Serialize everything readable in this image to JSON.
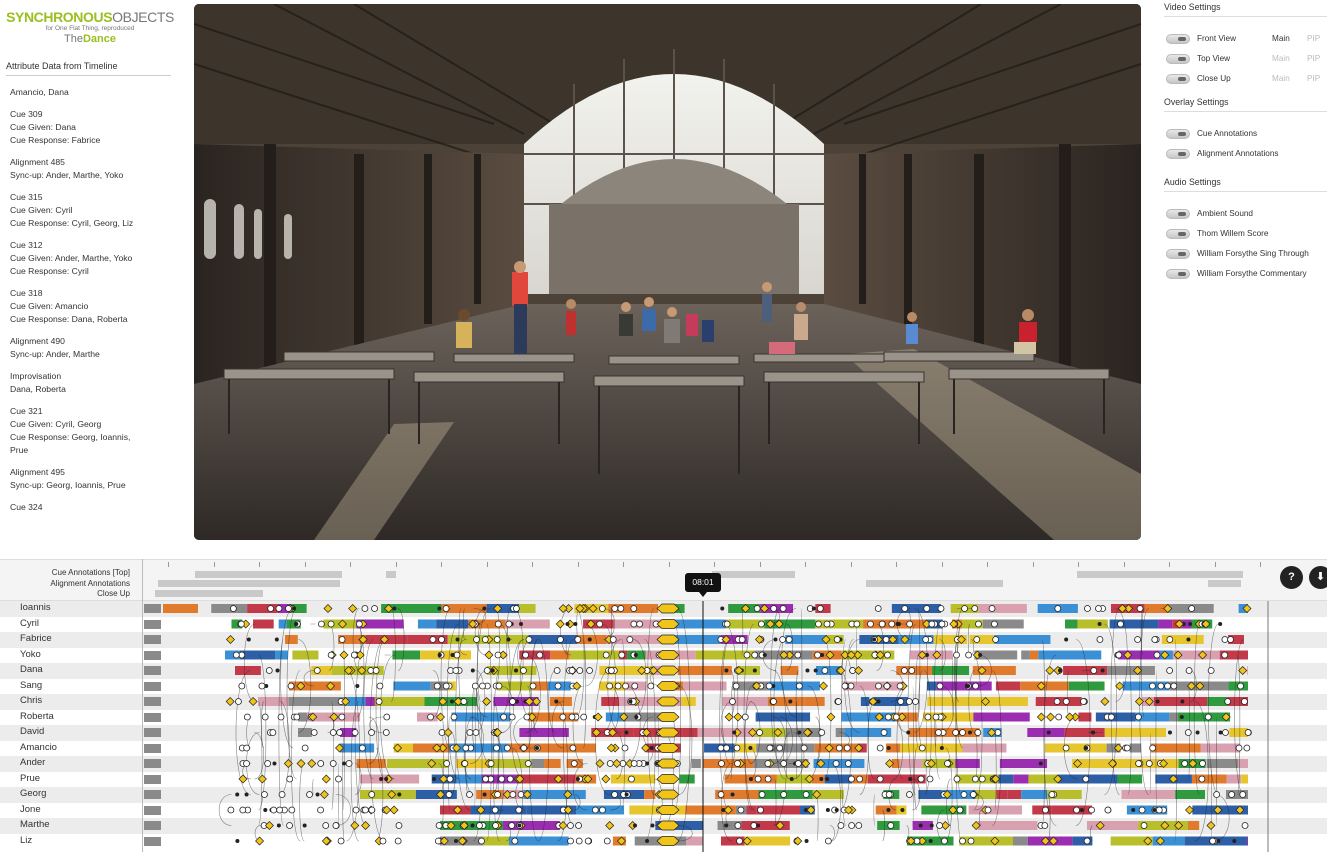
{
  "logo": {
    "main_a": "SYNCHRONOUS",
    "main_b": "OBJECTS",
    "sub": "for One Flat Thing, reproduced",
    "dance_a": "The",
    "dance_b": "Dance"
  },
  "attribute_panel": {
    "title": "Attribute Data from Timeline",
    "blocks": [
      [
        "Amancio, Dana"
      ],
      [
        "Cue 309",
        "Cue Given: Dana",
        "Cue Response: Fabrice"
      ],
      [
        "Alignment 485",
        "Sync-up: Ander, Marthe, Yoko"
      ],
      [
        "Cue 315",
        "Cue Given: Cyril",
        "Cue Response: Cyril, Georg, Liz"
      ],
      [
        "Cue 312",
        "Cue Given: Ander, Marthe, Yoko",
        "Cue Response: Cyril"
      ],
      [
        "Cue 318",
        "Cue Given: Amancio",
        "Cue Response: Dana, Roberta"
      ],
      [
        "Alignment 490",
        "Sync-up: Ander, Marthe"
      ],
      [
        "Improvisation",
        "Dana, Roberta"
      ],
      [
        "Cue 321",
        "Cue Given: Cyril, Georg",
        "Cue Response: Georg, Ioannis,",
        "Prue"
      ],
      [
        "Alignment 495",
        "Sync-up: Georg, Ioannis, Prue"
      ],
      [
        "Cue 324"
      ]
    ]
  },
  "video_settings": {
    "title": "Video Settings",
    "rows": [
      {
        "label": "Front View",
        "main": "Main",
        "pip": "PIP",
        "main_active": true
      },
      {
        "label": "Top View",
        "main": "Main",
        "pip": "PIP",
        "main_active": false
      },
      {
        "label": "Close Up",
        "main": "Main",
        "pip": "PIP",
        "main_active": false
      }
    ]
  },
  "overlay_settings": {
    "title": "Overlay Settings",
    "rows": [
      {
        "label": "Cue Annotations"
      },
      {
        "label": "Alignment Annotations"
      }
    ]
  },
  "audio_settings": {
    "title": "Audio Settings",
    "rows": [
      {
        "label": "Ambient Sound"
      },
      {
        "label": "Thom Willem Score"
      },
      {
        "label": "William Forsythe Sing Through"
      },
      {
        "label": "William Forsythe Commentary"
      }
    ]
  },
  "timeline": {
    "header_labels": [
      "Cue Annotations [Top]",
      "Alignment Annotations",
      "Close Up"
    ],
    "current_time": "08:01",
    "help_button": "?",
    "download_button": "⬇",
    "dancers": [
      "Ioannis",
      "Cyril",
      "Fabrice",
      "Yoko",
      "Dana",
      "Sang",
      "Chris",
      "Roberta",
      "David",
      "Amancio",
      "Ander",
      "Prue",
      "Georg",
      "Jone",
      "Marthe",
      "Liz"
    ],
    "palette": [
      "#3b8fd4",
      "#e07a2c",
      "#9a2db0",
      "#b8bf2a",
      "#2f9a3e",
      "#2c5fa6",
      "#e7c62d",
      "#c23a4a",
      "#8a8a8a",
      "#d9a0b0"
    ],
    "highlight_color": "#f0c419"
  }
}
